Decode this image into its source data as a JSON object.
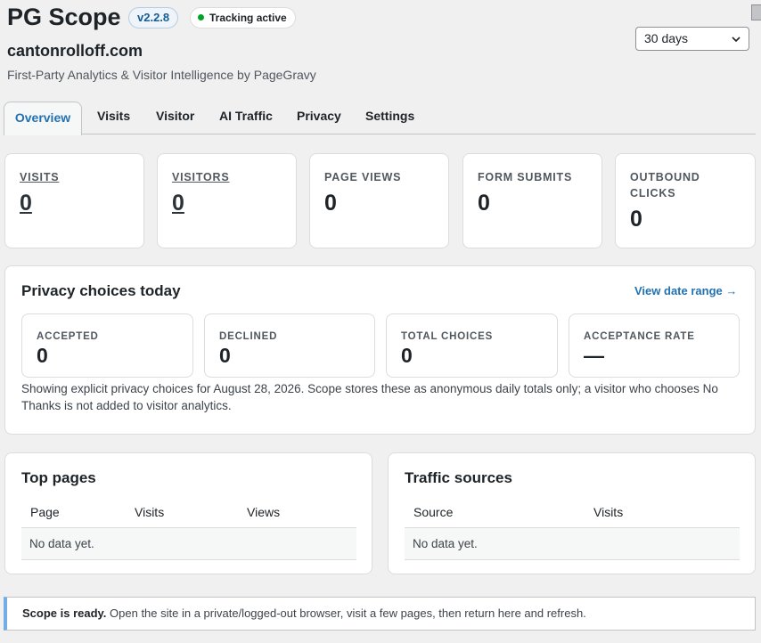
{
  "header": {
    "app_title": "PG Scope",
    "version": "v2.2.8",
    "tracking_status": "Tracking active",
    "site_domain": "cantonrolloff.com",
    "subtitle": "First-Party Analytics & Visitor Intelligence by PageGravy",
    "range_select": "30 days"
  },
  "tabs": [
    "Overview",
    "Visits",
    "Visitor",
    "AI Traffic",
    "Privacy",
    "Settings"
  ],
  "stats": [
    {
      "label": "VISITS",
      "value": "0"
    },
    {
      "label": "VISITORS",
      "value": "0"
    },
    {
      "label": "PAGE VIEWS",
      "value": "0"
    },
    {
      "label": "FORM SUBMITS",
      "value": "0"
    },
    {
      "label_line1": "OUTBOUND",
      "label_line2": "CLICKS",
      "value": "0"
    }
  ],
  "privacy": {
    "title": "Privacy choices today",
    "link": "View date range →",
    "cards": [
      {
        "label": "ACCEPTED",
        "value": "0"
      },
      {
        "label": "DECLINED",
        "value": "0"
      },
      {
        "label": "TOTAL CHOICES",
        "value": "0"
      },
      {
        "label": "ACCEPTANCE RATE",
        "value": "—"
      }
    ],
    "note_line1": "Showing explicit privacy choices for August 28, 2026. Scope stores these as anonymous daily totals only; a visitor who chooses No",
    "note_line2": "Thanks is not added to visitor analytics."
  },
  "top_pages": {
    "title": "Top pages",
    "columns": [
      "Page",
      "Visits",
      "Views"
    ],
    "empty": "No data yet."
  },
  "traffic_sources": {
    "title": "Traffic sources",
    "columns": [
      "Source",
      "Visits"
    ],
    "empty": "No data yet."
  },
  "notice": {
    "bold": "Scope is ready.",
    "text": " Open the site in a private/logged-out browser, visit a few pages, then return here and refresh."
  }
}
